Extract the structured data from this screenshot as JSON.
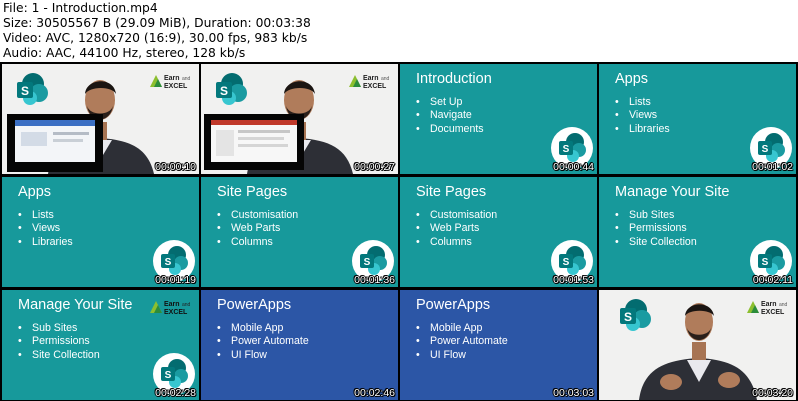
{
  "header": {
    "file_line": "File: 1 - Introduction.mp4",
    "size_line": "Size: 30505567 B (29.09 MiB), Duration: 00:03:38",
    "video_line": "Video: AVC, 1280x720 (16:9), 30.00 fps, 983 kb/s",
    "audio_line": "Audio: AAC, 44100 Hz, stereo, 128 kb/s"
  },
  "colors": {
    "teal": "#17999b",
    "blue": "#2c56a6",
    "sharepoint": "#0b7f85"
  },
  "brand": {
    "earn": "Earn",
    "and": "and",
    "excel": "EXCEL"
  },
  "tiles": [
    {
      "kind": "video",
      "timestamp": "00:00:10"
    },
    {
      "kind": "video",
      "timestamp": "00:00:27"
    },
    {
      "kind": "slide",
      "title": "Introduction",
      "bullets": [
        "Set Up",
        "Navigate",
        "Documents"
      ],
      "timestamp": "00:00:44"
    },
    {
      "kind": "slide",
      "title": "Apps",
      "bullets": [
        "Lists",
        "Views",
        "Libraries"
      ],
      "timestamp": "00:01:02"
    },
    {
      "kind": "slide",
      "title": "Apps",
      "bullets": [
        "Lists",
        "Views",
        "Libraries"
      ],
      "timestamp": "00:01:19"
    },
    {
      "kind": "slide",
      "title": "Site Pages",
      "bullets": [
        "Customisation",
        "Web Parts",
        "Columns"
      ],
      "timestamp": "00:01:36"
    },
    {
      "kind": "slide",
      "title": "Site Pages",
      "bullets": [
        "Customisation",
        "Web Parts",
        "Columns"
      ],
      "timestamp": "00:01:53"
    },
    {
      "kind": "slide",
      "title": "Manage Your Site",
      "bullets": [
        "Sub Sites",
        "Permissions",
        "Site Collection"
      ],
      "timestamp": "00:02:11"
    },
    {
      "kind": "slide",
      "title": "Manage Your Site",
      "bullets": [
        "Sub Sites",
        "Permissions",
        "Site Collection"
      ],
      "timestamp": "00:02:28"
    },
    {
      "kind": "slide",
      "title": "PowerApps",
      "bullets": [
        "Mobile App",
        "Power Automate",
        "UI Flow"
      ],
      "timestamp": "00:02:46"
    },
    {
      "kind": "slide",
      "title": "PowerApps",
      "bullets": [
        "Mobile App",
        "Power Automate",
        "UI Flow"
      ],
      "timestamp": "00:03:03"
    },
    {
      "kind": "video",
      "timestamp": "00:03:20"
    }
  ]
}
